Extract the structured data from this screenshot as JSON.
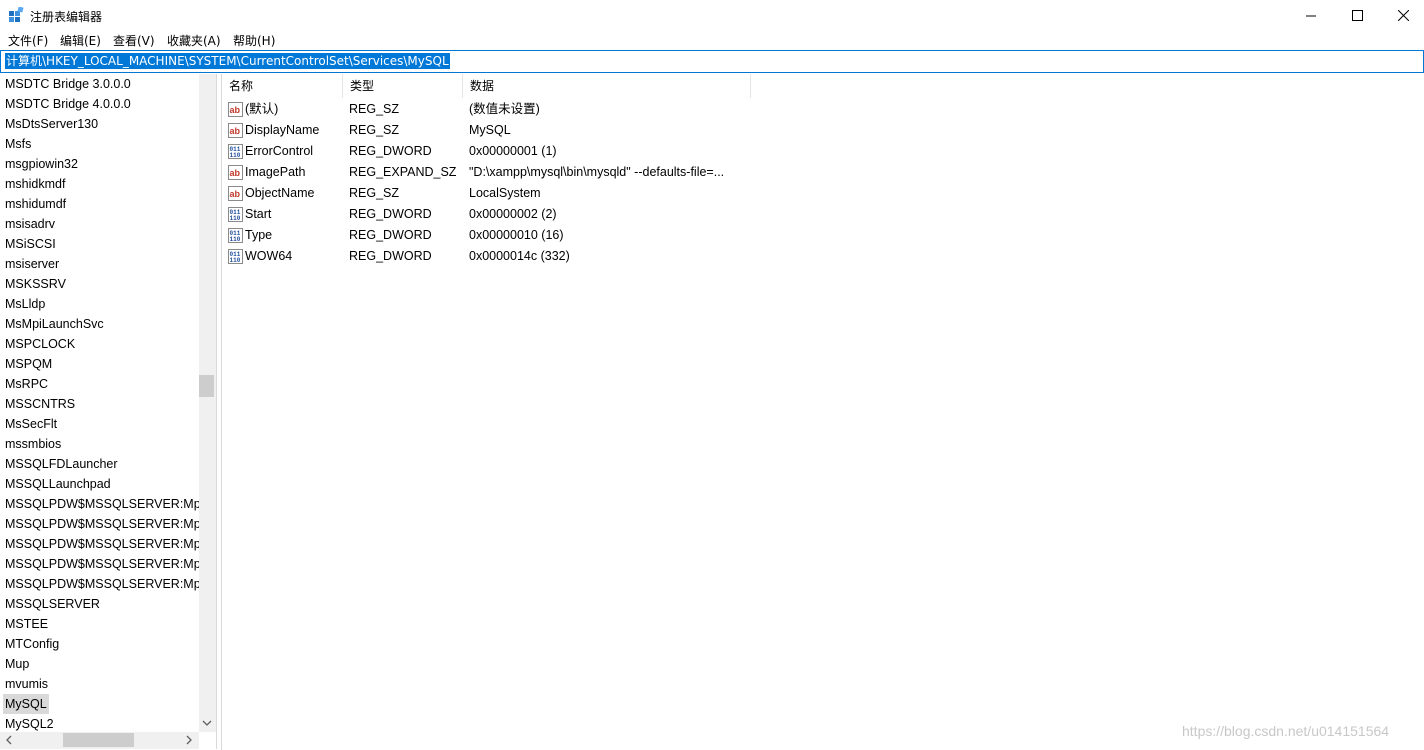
{
  "window": {
    "title": "注册表编辑器",
    "controls": {
      "minimize": "—",
      "maximize": "☐",
      "close": "✕"
    }
  },
  "menu": [
    "文件(F)",
    "编辑(E)",
    "查看(V)",
    "收藏夹(A)",
    "帮助(H)"
  ],
  "address": "计算机\\HKEY_LOCAL_MACHINE\\SYSTEM\\CurrentControlSet\\Services\\MySQL",
  "tree": {
    "items": [
      "MSDTC Bridge 3.0.0.0",
      "MSDTC Bridge 4.0.0.0",
      "MsDtsServer130",
      "Msfs",
      "msgpiowin32",
      "mshidkmdf",
      "mshidumdf",
      "msisadrv",
      "MSiSCSI",
      "msiserver",
      "MSKSSRV",
      "MsLldp",
      "MsMpiLaunchSvc",
      "MSPCLOCK",
      "MSPQM",
      "MsRPC",
      "MSSCNTRS",
      "MsSecFlt",
      "mssmbios",
      "MSSQLFDLauncher",
      "MSSQLLaunchpad",
      "MSSQLPDW$MSSQLSERVER:Mpp",
      "MSSQLPDW$MSSQLSERVER:Mpp",
      "MSSQLPDW$MSSQLSERVER:Mpp",
      "MSSQLPDW$MSSQLSERVER:Mpp",
      "MSSQLPDW$MSSQLSERVER:Mpp",
      "MSSQLSERVER",
      "MSTEE",
      "MTConfig",
      "Mup",
      "mvumis",
      "MySQL",
      "MySQL2"
    ],
    "selected": "MySQL"
  },
  "columns": {
    "name": "名称",
    "type": "类型",
    "data": "数据"
  },
  "values": [
    {
      "icon": "string-value-icon",
      "name": "(默认)",
      "type": "REG_SZ",
      "data": "(数值未设置)"
    },
    {
      "icon": "string-value-icon",
      "name": "DisplayName",
      "type": "REG_SZ",
      "data": "MySQL"
    },
    {
      "icon": "binary-value-icon",
      "name": "ErrorControl",
      "type": "REG_DWORD",
      "data": "0x00000001 (1)"
    },
    {
      "icon": "string-value-icon",
      "name": "ImagePath",
      "type": "REG_EXPAND_SZ",
      "data": "\"D:\\xampp\\mysql\\bin\\mysqld\" --defaults-file=..."
    },
    {
      "icon": "string-value-icon",
      "name": "ObjectName",
      "type": "REG_SZ",
      "data": "LocalSystem"
    },
    {
      "icon": "binary-value-icon",
      "name": "Start",
      "type": "REG_DWORD",
      "data": "0x00000002 (2)"
    },
    {
      "icon": "binary-value-icon",
      "name": "Type",
      "type": "REG_DWORD",
      "data": "0x00000010 (16)"
    },
    {
      "icon": "binary-value-icon",
      "name": "WOW64",
      "type": "REG_DWORD",
      "data": "0x0000014c (332)"
    }
  ],
  "watermark": "https://blog.csdn.net/u014151564",
  "colors": {
    "selection": "#0078d7",
    "tree_selected": "#d9d9d9",
    "string_icon": "#c0392b",
    "binary_icon": "#1f4e9c"
  }
}
